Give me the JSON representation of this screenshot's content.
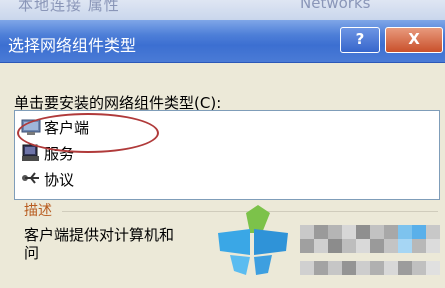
{
  "background_window": {
    "title_fragment": "本地连接 属性",
    "title_fragment2": "Networks"
  },
  "dialog": {
    "title": "选择网络组件类型",
    "help_button": "?",
    "close_button": "X",
    "prompt_text": "单击要安装的网络组件类型",
    "prompt_hotkey": "(C):"
  },
  "component_list": {
    "items": [
      {
        "label": "客户端",
        "icon": "client-computer-icon",
        "selected": true
      },
      {
        "label": "服务",
        "icon": "service-icon",
        "selected": false
      },
      {
        "label": "协议",
        "icon": "protocol-icon",
        "selected": false
      }
    ]
  },
  "description": {
    "heading": "描述",
    "text": "客户端提供对计算机和",
    "text_line2": "问"
  },
  "colors": {
    "titlebar": "#3c6fd1",
    "close_button": "#c9502b",
    "dialog_background": "#ece9d8",
    "annotation_circle": "#b03a3a",
    "description_heading": "#b85c20"
  }
}
